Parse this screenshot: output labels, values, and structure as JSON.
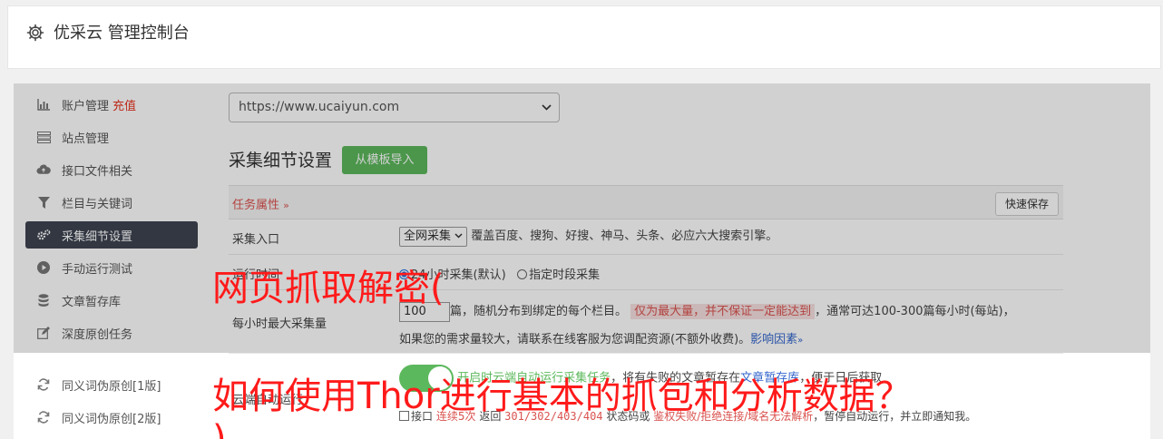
{
  "header": {
    "title": "优采云 管理控制台"
  },
  "sidebar": {
    "items": [
      {
        "label": "账户管理",
        "icon": "bar-chart-icon",
        "extra": "充值"
      },
      {
        "label": "站点管理",
        "icon": "server-icon"
      },
      {
        "label": "接口文件相关",
        "icon": "cloud-upload-icon"
      },
      {
        "label": "栏目与关键词",
        "icon": "filter-icon"
      },
      {
        "label": "采集细节设置",
        "icon": "gears-icon",
        "active": true
      },
      {
        "label": "手动运行测试",
        "icon": "play-circle-icon"
      },
      {
        "label": "文章暂存库",
        "icon": "database-icon"
      },
      {
        "label": "深度原创任务",
        "icon": "edit-icon"
      },
      {
        "label": "同义词伪原创[1版]",
        "icon": "refresh-icon"
      },
      {
        "label": "同义词伪原创[2版]",
        "icon": "refresh-icon"
      }
    ]
  },
  "site_select": {
    "value": "https://www.ucaiyun.com"
  },
  "section": {
    "title": "采集细节设置",
    "import_button": "从模板导入"
  },
  "panel": {
    "task_attr": "任务属性",
    "quick_save": "快速保存"
  },
  "rows": {
    "entry": {
      "label": "采集入口",
      "select_value": "全网采集",
      "desc": "覆盖百度、搜狗、好搜、神马、头条、必应六大搜索引擎。"
    },
    "time": {
      "label": "运行时间",
      "opt1": "24小时采集(默认)",
      "opt2": "指定时段采集"
    },
    "max": {
      "label": "每小时最大采集量",
      "value": "100",
      "text1": "篇，随机分布到绑定的每个栏目。",
      "warn": "仅为最大量，并不保证一定能达到",
      "text2": "，通常可达100-300篇每小时(每站)，",
      "text3": "如果您的需求量较大，请联系在线客服为您调配资源(不额外收费)。",
      "link": "影响因素"
    },
    "cloud": {
      "label": "云端自动运行",
      "toggle_text": "开启时云端自动运行采集任务",
      "text_mid": "，将有失败的文章暂存在",
      "link": "文章暂存库",
      "text_end": "，便于日后获取",
      "chk_label": "接口",
      "red1": "连续5次",
      "text_a": "返回",
      "codes": "301/302/403/404",
      "text_b": "状态码或",
      "red2": "鉴权失败/拒绝连接/域名无法解析",
      "text_c": "，暂停自动运行，并立即通知我。"
    }
  },
  "watermark": {
    "line1": "网页抓取解密(",
    "line2": "如何使用Thor进行基本的抓包和分析数据？",
    "line3": ")"
  }
}
